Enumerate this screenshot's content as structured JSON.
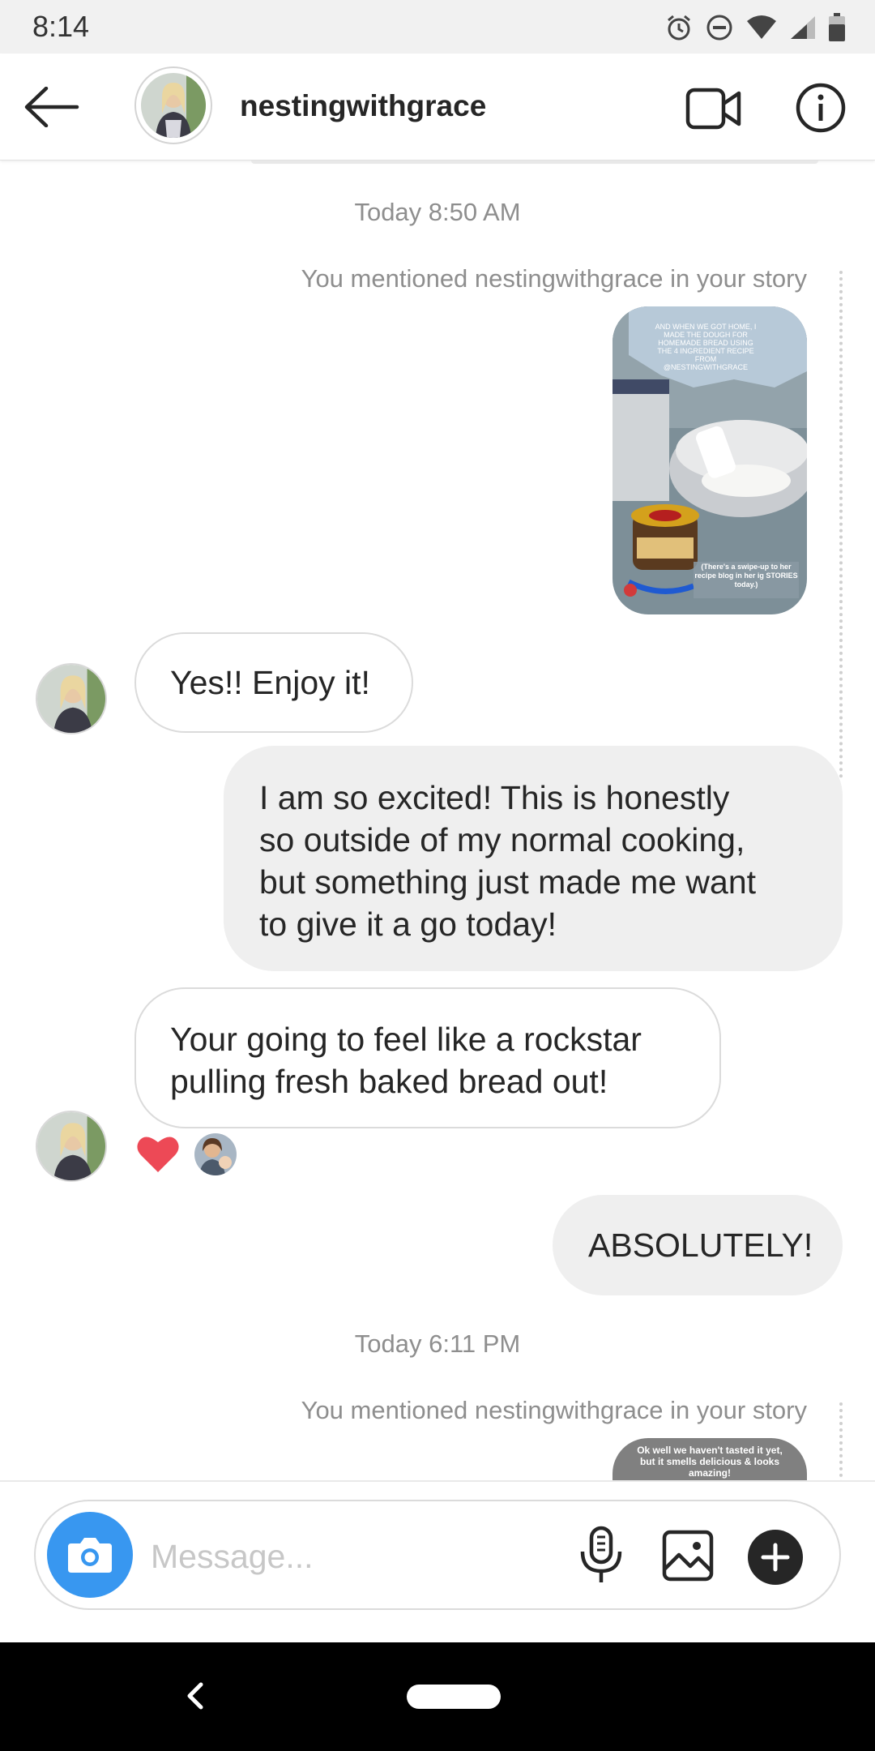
{
  "status_bar": {
    "time": "8:14",
    "icons": [
      "alarm-icon",
      "do-not-disturb-icon",
      "wifi-icon",
      "signal-icon",
      "battery-icon"
    ]
  },
  "header": {
    "username": "nestingwithgrace",
    "back_icon": "arrow-left-icon",
    "video_icon": "video-camera-icon",
    "info_icon": "info-icon"
  },
  "chat": {
    "timestamp_1": "Today 8:50 AM",
    "mention_1": "You mentioned nestingwithgrace in your story",
    "story_1": {
      "caption_top": "AND WHEN WE GOT HOME, I MADE THE DOUGH FOR HOMEMADE BREAD USING THE 4 INGREDIENT RECIPE FROM @NESTINGWITHGRACE",
      "caption_bottom": "(There's a swipe-up to her recipe blog in her ig STORIES today.)"
    },
    "messages": [
      {
        "direction": "incoming",
        "text": "Yes!! Enjoy it!"
      },
      {
        "direction": "outgoing",
        "lines": [
          "I am so excited! This is honestly",
          "so outside of my normal cooking,",
          "but something just made me want",
          "to give it a go today!"
        ]
      },
      {
        "direction": "incoming",
        "lines": [
          "Your going to feel like a rockstar",
          "pulling fresh baked bread out!"
        ],
        "reaction": "heart-icon"
      },
      {
        "direction": "outgoing",
        "text": "ABSOLUTELY!"
      }
    ],
    "timestamp_2": "Today 6:11 PM",
    "mention_2": "You mentioned nestingwithgrace in your story",
    "story_2": {
      "caption": "Ok well we haven't tasted it yet, but it smells delicious & looks amazing!"
    }
  },
  "composer": {
    "placeholder": "Message...",
    "camera_icon": "camera-icon",
    "mic_icon": "microphone-icon",
    "gallery_icon": "image-icon",
    "plus_icon": "plus-icon"
  },
  "colors": {
    "accent_blue": "#3897f0",
    "heart_red": "#ed4956",
    "outgoing_bubble": "#efefef",
    "meta_gray": "#8e8e8e"
  }
}
